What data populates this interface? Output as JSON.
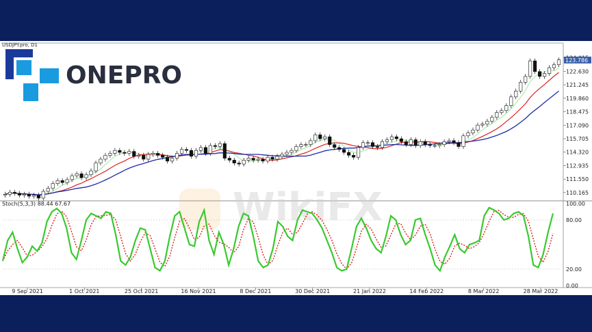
{
  "chart_data": [
    {
      "type": "candlestick",
      "symbol_label": "USDJPY.pro, D1",
      "y_ticks": [
        "124.015",
        "122.630",
        "121.245",
        "119.860",
        "118.475",
        "117.090",
        "115.705",
        "114.320",
        "112.935",
        "111.550",
        "110.165"
      ],
      "current_price": "123.786",
      "ylim": [
        109.6,
        124.9
      ],
      "x_ticks": [
        "9 Sep 2021",
        "1 Oct 2021",
        "25 Oct 2021",
        "16 Nov 2021",
        "8 Dec 2021",
        "30 Dec 2021",
        "21 Jan 2022",
        "14 Feb 2022",
        "8 Mar 2022",
        "28 Mar 2022"
      ],
      "close": [
        110.0,
        110.2,
        110.1,
        109.9,
        110.0,
        109.8,
        109.9,
        109.6,
        110.3,
        110.6,
        111.1,
        111.4,
        111.2,
        111.5,
        111.9,
        112.1,
        111.7,
        112.0,
        112.4,
        113.2,
        113.6,
        114.0,
        114.2,
        114.5,
        114.3,
        114.2,
        114.4,
        113.9,
        114.0,
        113.6,
        114.1,
        114.2,
        114.0,
        113.8,
        113.4,
        113.7,
        114.2,
        114.6,
        114.5,
        113.9,
        114.5,
        114.8,
        114.2,
        115.0,
        114.9,
        115.2,
        113.7,
        113.5,
        113.2,
        113.1,
        113.5,
        113.7,
        113.5,
        113.6,
        113.4,
        113.8,
        113.6,
        113.9,
        114.1,
        114.3,
        114.5,
        114.9,
        115.1,
        115.1,
        115.5,
        116.1,
        115.7,
        115.9,
        115.1,
        114.8,
        114.6,
        114.3,
        114.0,
        113.8,
        114.8,
        115.3,
        115.3,
        114.9,
        114.8,
        115.4,
        115.6,
        115.9,
        115.7,
        115.4,
        115.1,
        115.6,
        115.0,
        115.4,
        115.1,
        115.0,
        115.0,
        115.1,
        115.4,
        115.5,
        115.3,
        114.9,
        116.0,
        116.3,
        116.6,
        117.1,
        117.2,
        117.5,
        117.9,
        118.4,
        118.6,
        119.1,
        120.0,
        120.6,
        121.5,
        122.1,
        123.7,
        122.6,
        122.1,
        122.4,
        123.0,
        123.3,
        123.8
      ],
      "stochastic": {
        "label": "Stoch(5,3,3) 88.44 67.67",
        "main": 88.44,
        "signal": 67.67,
        "ylim": [
          0,
          100
        ],
        "y_ticks": [
          "100.00",
          "80.00",
          "20.00",
          "0.00"
        ],
        "main_values": [
          30,
          55,
          65,
          45,
          28,
          35,
          48,
          42,
          52,
          78,
          90,
          94,
          88,
          70,
          40,
          32,
          55,
          80,
          88,
          85,
          82,
          90,
          88,
          62,
          30,
          25,
          35,
          55,
          70,
          68,
          45,
          22,
          18,
          30,
          60,
          85,
          90,
          70,
          50,
          48,
          78,
          92,
          55,
          38,
          65,
          50,
          25,
          45,
          72,
          88,
          85,
          60,
          30,
          22,
          25,
          45,
          78,
          72,
          60,
          55,
          80,
          92,
          90,
          88,
          80,
          70,
          55,
          40,
          22,
          18,
          20,
          45,
          72,
          82,
          70,
          55,
          45,
          40,
          60,
          85,
          80,
          62,
          50,
          55,
          80,
          82,
          62,
          45,
          25,
          18,
          35,
          48,
          62,
          45,
          40,
          50,
          52,
          55,
          85,
          95,
          92,
          88,
          80,
          82,
          88,
          90,
          85,
          60,
          25,
          22,
          38,
          65,
          88
        ]
      },
      "colors": {
        "ma_fast": "#90e890",
        "ma_mid": "#dd2222",
        "ma_slow": "#1c2aa8",
        "stoch_main": "#38c92d",
        "stoch_signal": "#d92020",
        "bg": "#0a1f5c"
      }
    }
  ],
  "logo": {
    "text": "ONEPRO",
    "mark_color": "#1a9be0",
    "mark_dark": "#1a3a9a"
  },
  "watermark_text": "WikiFX"
}
